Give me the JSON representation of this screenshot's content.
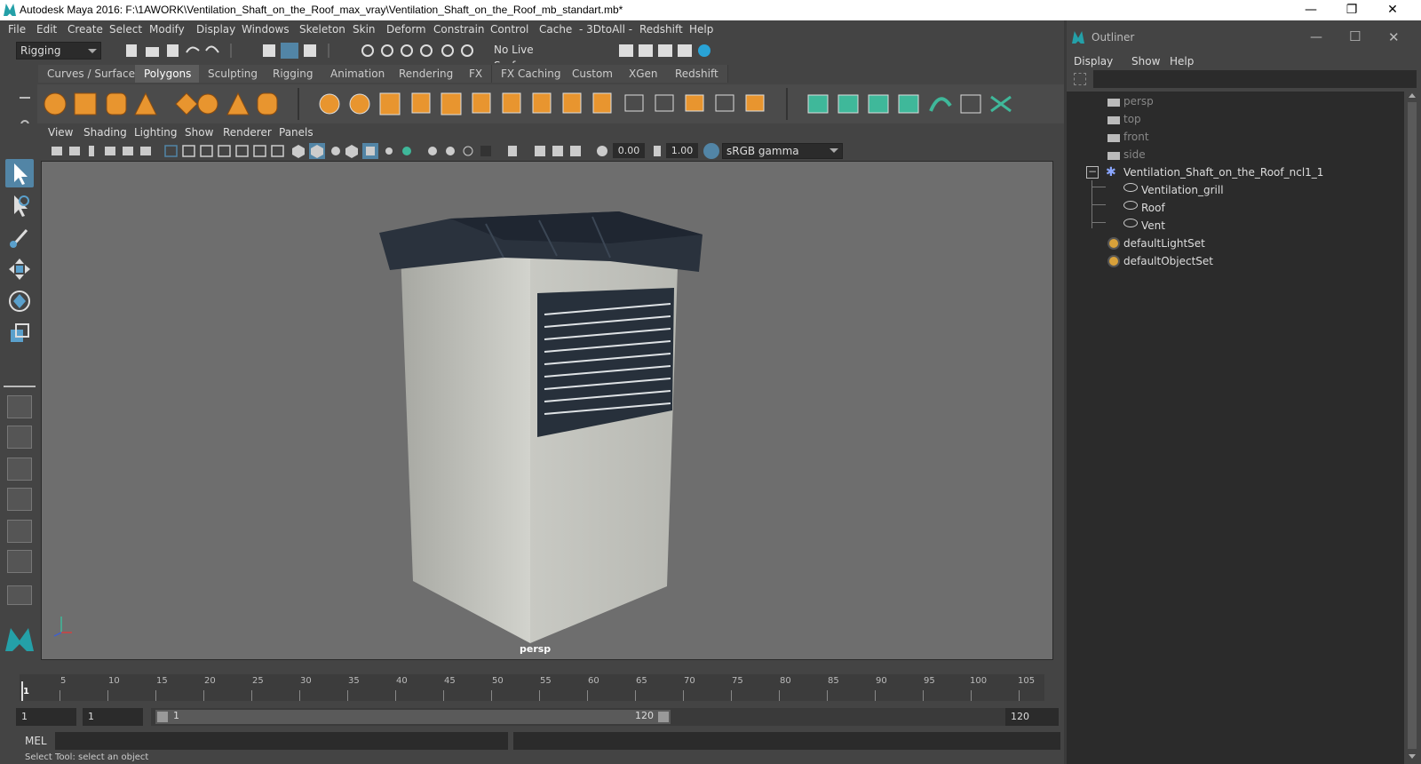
{
  "window": {
    "title": "Autodesk Maya 2016: F:\\1AWORK\\Ventilation_Shaft_on_the_Roof_max_vray\\Ventilation_Shaft_on_the_Roof_mb_standart.mb*",
    "min_glyph": "—",
    "max_glyph": "❐",
    "close_glyph": "✕"
  },
  "menubar": [
    "File",
    "Edit",
    "Create",
    "Select",
    "Modify",
    "Display",
    "Windows",
    "Skeleton",
    "Skin",
    "Deform",
    "Constrain",
    "Control",
    "Cache",
    "- 3DtoAll -",
    "Redshift",
    "Help"
  ],
  "statusline": {
    "menuset": "Rigging",
    "live_surface": "No Live Surface"
  },
  "shelf": {
    "tabs": [
      "Curves / Surfaces",
      "Polygons",
      "Sculpting",
      "Rigging",
      "Animation",
      "Rendering",
      "FX",
      "FX Caching",
      "Custom",
      "XGen",
      "Redshift"
    ],
    "active_tab": "Polygons"
  },
  "viewport": {
    "menu": [
      "View",
      "Shading",
      "Lighting",
      "Show",
      "Renderer",
      "Panels"
    ],
    "exposure": "0.00",
    "gamma": "1.00",
    "color_space": "sRGB gamma",
    "camera_label": "persp"
  },
  "timeline": {
    "ticks": [
      "5",
      "10",
      "15",
      "20",
      "25",
      "30",
      "35",
      "40",
      "45",
      "50",
      "55",
      "60",
      "65",
      "70",
      "75",
      "80",
      "85",
      "90",
      "95",
      "100",
      "105"
    ],
    "current_frame": "1"
  },
  "range": {
    "start": "1",
    "current": "1",
    "slider_start": "1",
    "slider_end": "120",
    "end": "120"
  },
  "command": {
    "label": "MEL"
  },
  "helpline": "Select Tool: select an object",
  "outliner": {
    "title": "Outliner",
    "menu": [
      "Display",
      "Show",
      "Help"
    ],
    "items": [
      {
        "label": "persp",
        "dim": true
      },
      {
        "label": "top",
        "dim": true
      },
      {
        "label": "front",
        "dim": true
      },
      {
        "label": "side",
        "dim": true
      },
      {
        "label": "Ventilation_Shaft_on_the_Roof_ncl1_1",
        "dim": false
      },
      {
        "label": "Ventilation_grill",
        "dim": false
      },
      {
        "label": "Roof",
        "dim": false
      },
      {
        "label": "Vent",
        "dim": false
      },
      {
        "label": "defaultLightSet",
        "dim": false
      },
      {
        "label": "defaultObjectSet",
        "dim": false
      }
    ]
  },
  "colors": {
    "accent": "#5285a6",
    "background": "#444444",
    "viewport": "#6e6e6e",
    "roof": "#28313c",
    "wall": "#c9cac4"
  }
}
